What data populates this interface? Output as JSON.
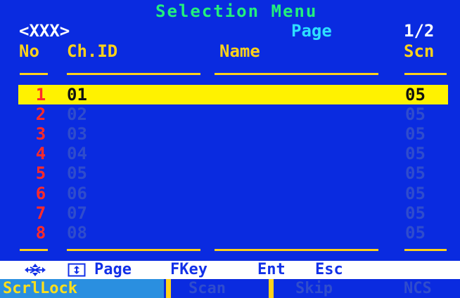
{
  "title": "Selection Menu",
  "breadcrumb": "<XXX>",
  "page": {
    "label": "Page",
    "value": "1/2"
  },
  "columns": {
    "no": "No",
    "chid": "Ch.ID",
    "name": "Name",
    "scn": "Scn"
  },
  "rows": [
    {
      "no": "1",
      "chid": "01",
      "name": "",
      "scn": "05"
    },
    {
      "no": "2",
      "chid": "02",
      "name": "",
      "scn": "05"
    },
    {
      "no": "3",
      "chid": "03",
      "name": "",
      "scn": "05"
    },
    {
      "no": "4",
      "chid": "04",
      "name": "",
      "scn": "05"
    },
    {
      "no": "5",
      "chid": "05",
      "name": "",
      "scn": "05"
    },
    {
      "no": "6",
      "chid": "06",
      "name": "",
      "scn": "05"
    },
    {
      "no": "7",
      "chid": "07",
      "name": "",
      "scn": "05"
    },
    {
      "no": "8",
      "chid": "08",
      "name": "",
      "scn": "05"
    }
  ],
  "selected_row": 0,
  "keys": {
    "page": "Page",
    "fkey": "FKey",
    "ent": "Ent",
    "esc": "Esc"
  },
  "status": {
    "scrllock": "ScrlLock",
    "scan": "Scan",
    "skip": "Skip",
    "ncs": "NCS"
  },
  "colors": {
    "background": "#0a2be0",
    "selection": "#fff200",
    "title": "#22f07c",
    "accent": "#ffd21a",
    "number": "#ff2a2a",
    "key_bar": "#ffffff"
  },
  "icons": {
    "arrows": "four-way-arrows-icon",
    "updown": "up-down-arrow-key-icon"
  }
}
